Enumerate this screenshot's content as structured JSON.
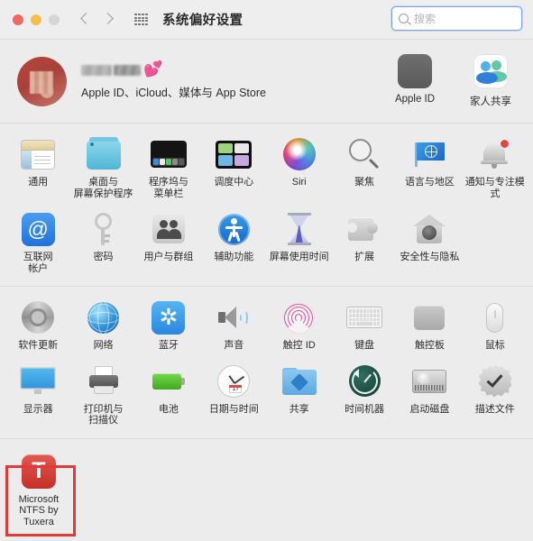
{
  "window": {
    "title": "系统偏好设置",
    "traffic_lights": [
      "close",
      "minimize",
      "zoom"
    ],
    "back_label": "后退",
    "forward_label": "前进",
    "showall_label": "显示全部"
  },
  "search": {
    "placeholder": "搜索",
    "value": "",
    "icon": "search-icon",
    "focused": true,
    "focus_color": "#7ba4e8"
  },
  "apple_id_banner": {
    "name_redacted": true,
    "emoji": "💕",
    "subtitle": "Apple ID、iCloud、媒体与 App Store",
    "actions": [
      {
        "label": "Apple ID",
        "icon": "apple-logo-icon"
      },
      {
        "label": "家人共享",
        "icon": "family-sharing-icon"
      }
    ]
  },
  "sections": [
    {
      "id": "personal",
      "rows": [
        [
          {
            "label": "通用",
            "icon": "general-icon"
          },
          {
            "label": "桌面与\n屏幕保护程序",
            "icon": "desktop-screensaver-icon"
          },
          {
            "label": "程序坞与\n菜单栏",
            "icon": "dock-menubar-icon"
          },
          {
            "label": "调度中心",
            "icon": "mission-control-icon"
          },
          {
            "label": "Siri",
            "icon": "siri-icon"
          },
          {
            "label": "聚焦",
            "icon": "spotlight-icon"
          },
          {
            "label": "语言与地区",
            "icon": "language-region-icon"
          },
          {
            "label": "通知与专注模式",
            "icon": "notifications-focus-icon"
          }
        ],
        [
          {
            "label": "互联网\n帐户",
            "icon": "internet-accounts-icon"
          },
          {
            "label": "密码",
            "icon": "passwords-key-icon"
          },
          {
            "label": "用户与群组",
            "icon": "users-groups-icon"
          },
          {
            "label": "辅助功能",
            "icon": "accessibility-icon"
          },
          {
            "label": "屏幕使用时间",
            "icon": "screen-time-icon"
          },
          {
            "label": "扩展",
            "icon": "extensions-puzzle-icon"
          },
          {
            "label": "安全性与隐私",
            "icon": "security-privacy-icon"
          }
        ]
      ]
    },
    {
      "id": "hardware",
      "rows": [
        [
          {
            "label": "软件更新",
            "icon": "software-update-icon"
          },
          {
            "label": "网络",
            "icon": "network-globe-icon"
          },
          {
            "label": "蓝牙",
            "icon": "bluetooth-icon"
          },
          {
            "label": "声音",
            "icon": "sound-speaker-icon"
          },
          {
            "label": "触控 ID",
            "icon": "touch-id-icon"
          },
          {
            "label": "键盘",
            "icon": "keyboard-icon"
          },
          {
            "label": "触控板",
            "icon": "trackpad-icon"
          },
          {
            "label": "鼠标",
            "icon": "mouse-icon"
          }
        ],
        [
          {
            "label": "显示器",
            "icon": "displays-icon"
          },
          {
            "label": "打印机与\n扫描仪",
            "icon": "printers-scanners-icon"
          },
          {
            "label": "电池",
            "icon": "battery-icon"
          },
          {
            "label": "日期与时间",
            "icon": "date-time-clock-icon",
            "clock_day": "17"
          },
          {
            "label": "共享",
            "icon": "sharing-folder-icon"
          },
          {
            "label": "时间机器",
            "icon": "time-machine-icon"
          },
          {
            "label": "启动磁盘",
            "icon": "startup-disk-icon"
          },
          {
            "label": "描述文件",
            "icon": "profiles-badge-icon"
          }
        ]
      ]
    },
    {
      "id": "third-party",
      "rows": [
        [
          {
            "label": "Microsoft\nNTFS by Tuxera",
            "icon": "tuxera-ntfs-icon",
            "highlighted": true
          }
        ]
      ]
    }
  ],
  "annotation": {
    "type": "rectangle",
    "color": "#e03a3a",
    "target": "Microsoft NTFS by Tuxera"
  }
}
